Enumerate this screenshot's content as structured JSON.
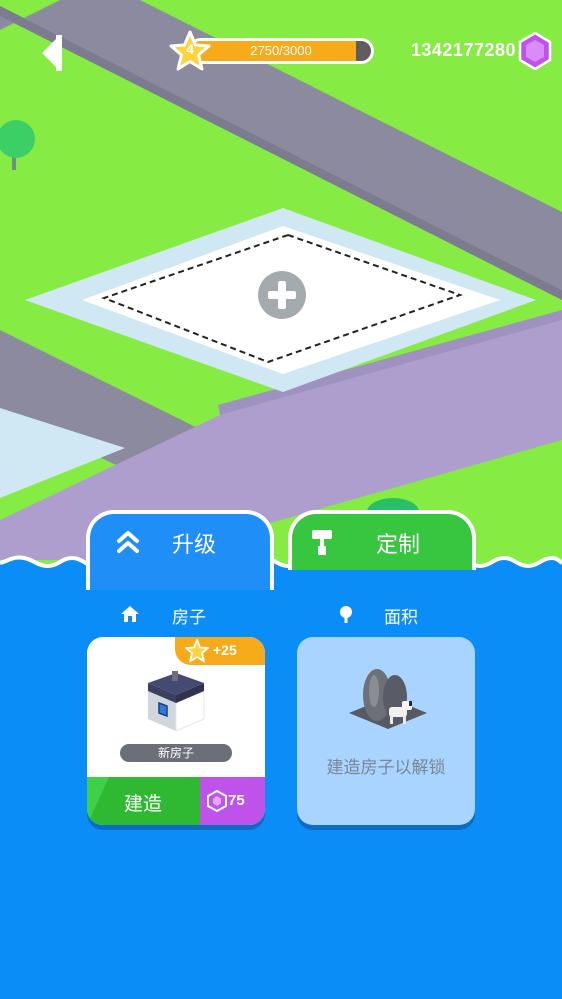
{
  "hud": {
    "level": "4",
    "xp_text": "2750/3000",
    "xp_progress": 0.9167,
    "gems": "1342177280"
  },
  "tabs": [
    {
      "label": "升级",
      "icon": "chevrons-up-icon",
      "active": true
    },
    {
      "label": "定制",
      "icon": "paint-roller-icon",
      "active": false
    }
  ],
  "sections": {
    "house": {
      "label": "房子",
      "icon": "house-icon"
    },
    "area": {
      "label": "面积",
      "icon": "tree-icon"
    }
  },
  "house_card": {
    "reward": "+25",
    "name": "新房子",
    "build_label": "建造",
    "cost": "75"
  },
  "area_card": {
    "locked_text": "建造房子以解锁"
  },
  "colors": {
    "grass": "#86ec44",
    "road": "#8a8a9e",
    "lilac_road": "#ae9fce",
    "water": "#0a8df7",
    "gem": "#c052ec",
    "star": "#f7ab1b",
    "build_green": "#2fb832"
  }
}
